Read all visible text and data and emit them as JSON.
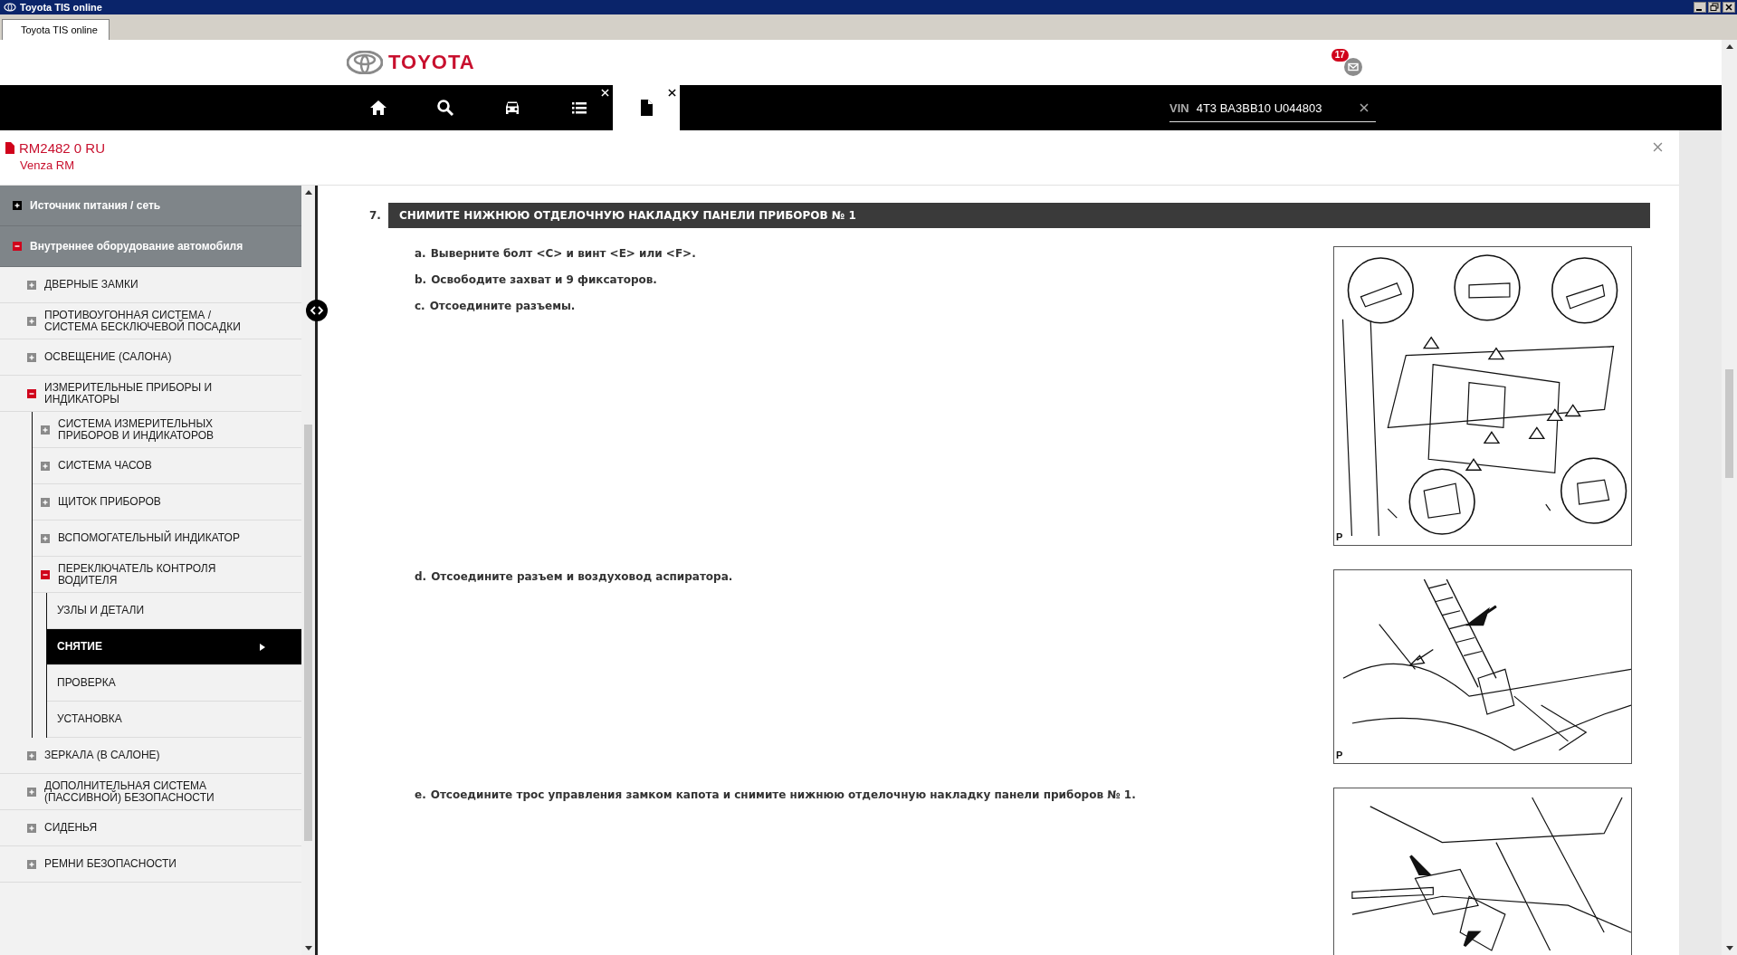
{
  "window": {
    "title": "Toyota TIS online",
    "tab": "Toyota TIS online"
  },
  "header": {
    "logo_text": "TOYOTA",
    "notifications": "17"
  },
  "nav": {
    "items": [
      {
        "kind": "home",
        "selected": false,
        "closable": false
      },
      {
        "kind": "search",
        "selected": false,
        "closable": false
      },
      {
        "kind": "vehicle",
        "selected": false,
        "closable": false
      },
      {
        "kind": "list",
        "selected": false,
        "closable": true
      },
      {
        "kind": "document",
        "selected": true,
        "closable": true
      }
    ],
    "vin": {
      "label": "VIN",
      "value": "4T3 BA3BB10 U044803"
    }
  },
  "document": {
    "code": "RM2482 0 RU",
    "model": "Venza RM"
  },
  "sidebar": {
    "items": [
      {
        "label": "Источник питания / сеть",
        "expanded": false,
        "selected": false
      },
      {
        "label": "Внутреннее оборудование автомобиля",
        "expanded": true,
        "selected": false,
        "children": [
          {
            "label": "ДВЕРНЫЕ ЗАМКИ",
            "expanded": false,
            "selected": false
          },
          {
            "label": "ПРОТИВОУГОННАЯ СИСТЕМА / СИСТЕМА БЕСКЛЮЧЕВОЙ ПОСАДКИ",
            "expanded": false,
            "selected": false
          },
          {
            "label": "ОСВЕЩЕНИЕ (САЛОНА)",
            "expanded": false,
            "selected": false
          },
          {
            "label": "ИЗМЕРИТЕЛЬНЫЕ ПРИБОРЫ И ИНДИКАТОРЫ",
            "expanded": true,
            "selected": false,
            "children": [
              {
                "label": "СИСТЕМА ИЗМЕРИТЕЛЬНЫХ ПРИБОРОВ И ИНДИКАТОРОВ",
                "expanded": false,
                "selected": false
              },
              {
                "label": "СИСТЕМА ЧАСОВ",
                "expanded": false,
                "selected": false
              },
              {
                "label": "ЩИТОК ПРИБОРОВ",
                "expanded": false,
                "selected": false
              },
              {
                "label": "ВСПОМОГАТЕЛЬНЫЙ ИНДИКАТОР",
                "expanded": false,
                "selected": false
              },
              {
                "label": "ПЕРЕКЛЮЧАТЕЛЬ КОНТРОЛЯ ВОДИТЕЛЯ",
                "expanded": true,
                "selected": false,
                "children": [
                  {
                    "label": "УЗЛЫ И ДЕТАЛИ",
                    "selected": false
                  },
                  {
                    "label": "СНЯТИЕ",
                    "selected": true
                  },
                  {
                    "label": "ПРОВЕРКА",
                    "selected": false
                  },
                  {
                    "label": "УСТАНОВКА",
                    "selected": false
                  }
                ]
              }
            ]
          },
          {
            "label": "ЗЕРКАЛА (В САЛОНЕ)",
            "expanded": false,
            "selected": false
          },
          {
            "label": "ДОПОЛНИТЕЛЬНАЯ СИСТЕМА (ПАССИВНОЙ) БЕЗОПАСНОСТИ",
            "expanded": false,
            "selected": false
          },
          {
            "label": "СИДЕНЬЯ",
            "expanded": false,
            "selected": false
          },
          {
            "label": "РЕМНИ БЕЗОПАСНОСТИ",
            "expanded": false,
            "selected": false
          }
        ]
      }
    ]
  },
  "content": {
    "step": {
      "number": "7.",
      "title": "СНИМИТЕ НИЖНЮЮ ОТДЕЛОЧНУЮ НАКЛАДКУ ПАНЕЛИ ПРИБОРОВ № 1"
    },
    "blocks": [
      {
        "instructions": [
          {
            "letter": "a.",
            "text": "Выверните болт <C> и винт <E> или <F>."
          },
          {
            "letter": "b.",
            "text": "Освободите захват и 9 фиксаторов."
          },
          {
            "letter": "c.",
            "text": "Отсоедините разъемы."
          }
        ],
        "figure": {
          "kind": "illustration",
          "label": "P"
        }
      },
      {
        "instructions": [
          {
            "letter": "d.",
            "text": "Отсоедините разъем и воздуховод аспиратора."
          }
        ],
        "figure": {
          "kind": "illustration",
          "label": "P"
        }
      },
      {
        "instructions": [
          {
            "letter": "e.",
            "text": "Отсоедините трос управления замком капота и снимите нижнюю отделочную накладку панели приборов № 1."
          }
        ],
        "figure": {
          "kind": "illustration"
        }
      }
    ]
  }
}
